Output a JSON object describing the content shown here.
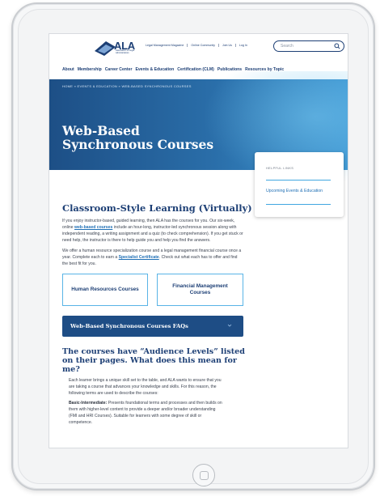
{
  "header": {
    "logo_text": "ALA",
    "logo_subtitle": "Association of Legal Administrators",
    "util_links": [
      "Legal Management Magazine",
      "Online Community",
      "Join Us",
      "Log In"
    ],
    "search_placeholder": "Search"
  },
  "nav": {
    "items": [
      "About",
      "Membership",
      "Career Center",
      "Events & Education",
      "Certification (CLM)",
      "Publications",
      "Resources by Topic"
    ]
  },
  "hero": {
    "breadcrumb": "HOME  »  EVENTS & EDUCATION  »  WEB-BASED SYNCHRONOUS COURSES",
    "title": "Web-Based Synchronous Courses"
  },
  "sidebar": {
    "heading": "HELPFUL LINKS",
    "link": "Upcoming Events & Education"
  },
  "main": {
    "heading": "Classroom-Style Learning (Virtually)",
    "para1_a": "If you enjoy instructor-based, guided learning, then ALA has the courses for you. Our six-week, online ",
    "para1_link": "web-based courses",
    "para1_b": " include an hour-long, instructor-led synchronous session along with independent reading, a writing assignment and a quiz (to check comprehension). If you get stuck or need help, the instructor is there to help guide you and help you find the answers.",
    "para2_a": "We offer a human resource specialization course and a legal management financial course once a year. Complete each to earn a ",
    "para2_link": "Specialist Certificate",
    "para2_b": ". Check out what each has to offer and find the best fit for you.",
    "card1": "Human Resources Courses",
    "card2": "Financial Management Courses",
    "faq_label": "Web-Based Synchronous Courses FAQs",
    "h3": "The courses have “Audience Levels” listed on their pages. What does this mean for me?",
    "para3": "Each learner brings a unique skill set to the table, and ALA wants to ensure that you are taking a course that advances your knowledge and skills. For this reason, the following terms are used to describe the courses:",
    "para4_bold": "Basic-Intermediate:",
    "para4": " Presents foundational terms and processes and then builds on them with higher-level content to provide a deeper and/or broader understanding (FMI and HRI Courses). Suitable for learners with some degree of skill or competence."
  }
}
